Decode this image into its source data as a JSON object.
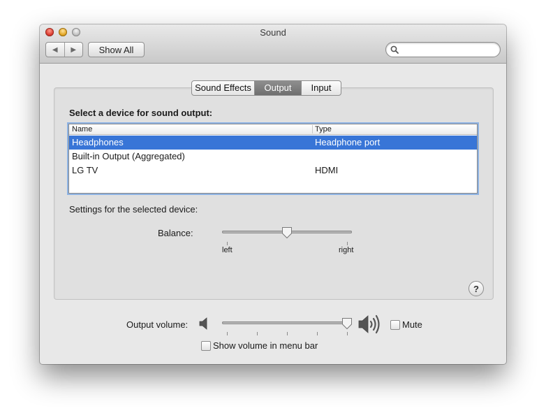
{
  "window": {
    "title": "Sound"
  },
  "toolbar": {
    "back_icon": "back-triangle-icon",
    "forward_icon": "forward-triangle-icon",
    "show_all_label": "Show All",
    "search_value": "",
    "search_placeholder": ""
  },
  "tabs": [
    {
      "label": "Sound Effects",
      "active": false
    },
    {
      "label": "Output",
      "active": true
    },
    {
      "label": "Input",
      "active": false
    }
  ],
  "output": {
    "heading": "Select a device for sound output:",
    "columns": [
      "Name",
      "Type"
    ],
    "devices": [
      {
        "name": "Headphones",
        "type": "Headphone port",
        "selected": true
      },
      {
        "name": "Built-in Output (Aggregated)",
        "type": "",
        "selected": false
      },
      {
        "name": "LG TV",
        "type": "HDMI",
        "selected": false
      }
    ],
    "settings_label": "Settings for the selected device:",
    "balance": {
      "label": "Balance:",
      "left_label": "left",
      "right_label": "right",
      "value": 0.5
    }
  },
  "help_label": "?",
  "volume": {
    "label": "Output volume:",
    "value": 0.96,
    "mute_label": "Mute",
    "mute_checked": false,
    "show_in_menu_bar_label": "Show volume in menu bar",
    "show_in_menu_bar_checked": false
  },
  "colors": {
    "selection": "#3875d7",
    "focus_ring": "#8db2e3",
    "active_tab": "#7d7d7d"
  }
}
